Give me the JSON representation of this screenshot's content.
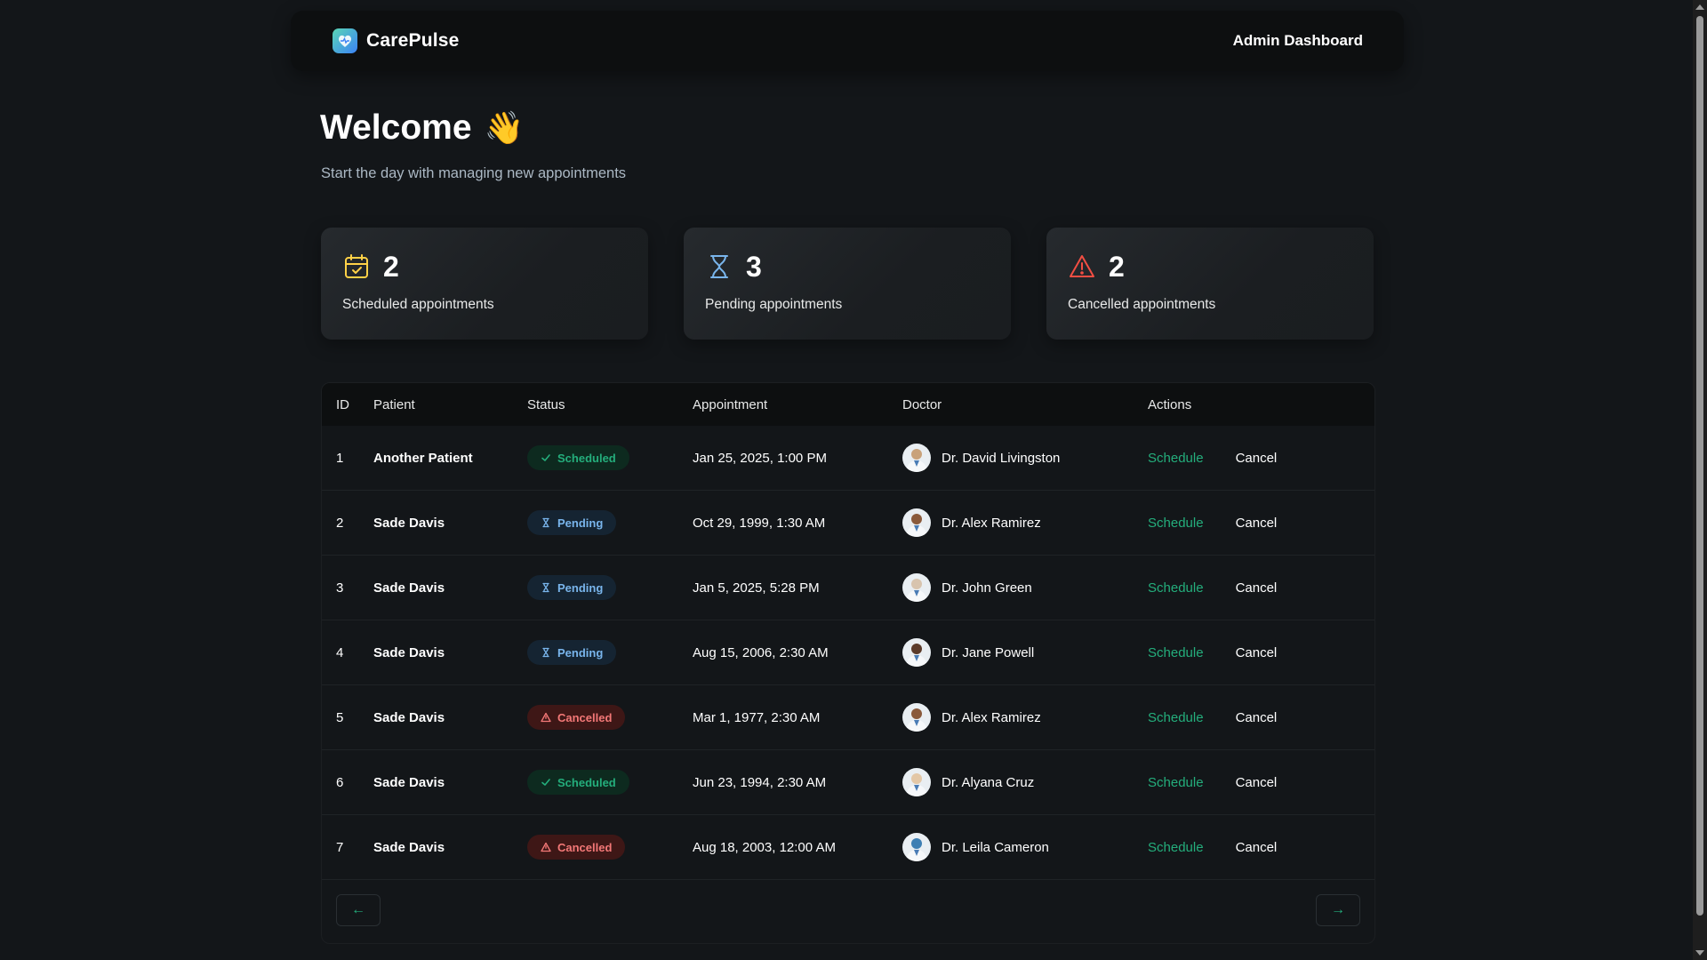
{
  "header": {
    "brand": "CarePulse",
    "admin_label": "Admin Dashboard"
  },
  "welcome": {
    "title": "Welcome",
    "emoji": "👋",
    "subtitle": "Start the day with managing new appointments"
  },
  "stats": [
    {
      "count": "2",
      "label": "Scheduled appointments",
      "icon": "calendar-check-icon",
      "color": "#FFD147"
    },
    {
      "count": "3",
      "label": "Pending appointments",
      "icon": "hourglass-icon",
      "color": "#79B5EC"
    },
    {
      "count": "2",
      "label": "Cancelled appointments",
      "icon": "alert-triangle-icon",
      "color": "#F24E43"
    }
  ],
  "table": {
    "columns": [
      "ID",
      "Patient",
      "Status",
      "Appointment",
      "Doctor",
      "Actions"
    ],
    "rows": [
      {
        "id": "1",
        "patient": "Another Patient",
        "status": "Scheduled",
        "appointment": "Jan 25, 2025, 1:00 PM",
        "doctor": "Dr. David Livingston",
        "schedule": "Schedule",
        "cancel": "Cancel"
      },
      {
        "id": "2",
        "patient": "Sade Davis",
        "status": "Pending",
        "appointment": "Oct 29, 1999, 1:30 AM",
        "doctor": "Dr. Alex Ramirez",
        "schedule": "Schedule",
        "cancel": "Cancel"
      },
      {
        "id": "3",
        "patient": "Sade Davis",
        "status": "Pending",
        "appointment": "Jan 5, 2025, 5:28 PM",
        "doctor": "Dr. John Green",
        "schedule": "Schedule",
        "cancel": "Cancel"
      },
      {
        "id": "4",
        "patient": "Sade Davis",
        "status": "Pending",
        "appointment": "Aug 15, 2006, 2:30 AM",
        "doctor": "Dr. Jane Powell",
        "schedule": "Schedule",
        "cancel": "Cancel"
      },
      {
        "id": "5",
        "patient": "Sade Davis",
        "status": "Cancelled",
        "appointment": "Mar 1, 1977, 2:30 AM",
        "doctor": "Dr. Alex Ramirez",
        "schedule": "Schedule",
        "cancel": "Cancel"
      },
      {
        "id": "6",
        "patient": "Sade Davis",
        "status": "Scheduled",
        "appointment": "Jun 23, 1994, 2:30 AM",
        "doctor": "Dr. Alyana Cruz",
        "schedule": "Schedule",
        "cancel": "Cancel"
      },
      {
        "id": "7",
        "patient": "Sade Davis",
        "status": "Cancelled",
        "appointment": "Aug 18, 2003, 12:00 AM",
        "doctor": "Dr. Leila Cameron",
        "schedule": "Schedule",
        "cancel": "Cancel"
      }
    ]
  },
  "pagination": {
    "prev": "←",
    "next": "→"
  },
  "colors": {
    "accent_green": "#24AE7C",
    "pending_blue": "#79B5EC",
    "cancel_red": "#F37877",
    "background": "#131619"
  }
}
